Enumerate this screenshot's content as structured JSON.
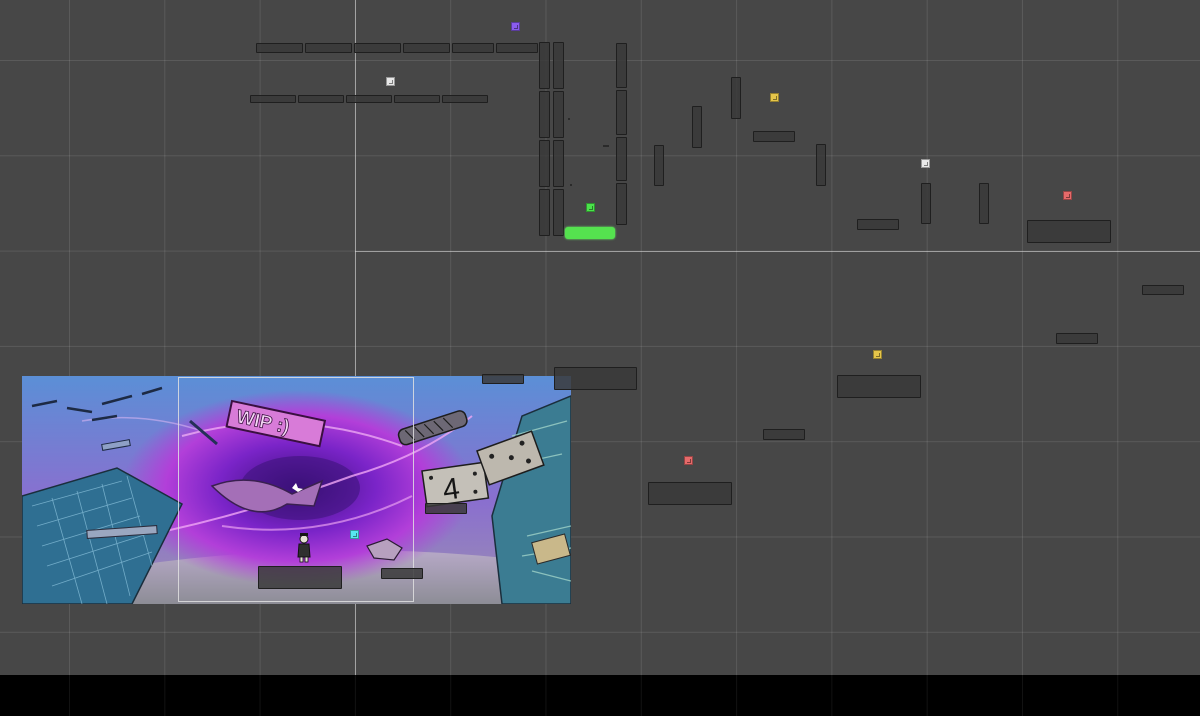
{
  "scene": {
    "background_color": "#474747",
    "grid_color": "#5a5a5a",
    "bottom_bar_color": "#000000",
    "platform_fill": "#3a3a3a",
    "platform_outline": "#1f1f1f",
    "goal_platform_color": "#55e24f"
  },
  "markers": [
    {
      "color": "#8a5cf0",
      "icon": "purple-marker-icon"
    },
    {
      "color": "#e8e8e8",
      "icon": "white-marker-icon"
    },
    {
      "color": "#e6c64a",
      "icon": "yellow-marker-icon"
    },
    {
      "color": "#e8e8e8",
      "icon": "white-marker-icon"
    },
    {
      "color": "#e66a6a",
      "icon": "red-marker-icon"
    },
    {
      "color": "#4be34b",
      "icon": "green-marker-icon"
    },
    {
      "color": "#e6c64a",
      "icon": "yellow-marker-icon"
    },
    {
      "color": "#e66a6a",
      "icon": "red-marker-icon"
    },
    {
      "color": "#58e6f0",
      "icon": "cyan-marker-icon"
    }
  ],
  "background_art": {
    "sign_text": "WIP :)",
    "dice_number": "4",
    "sky_color": "#6a8ad0",
    "vortex_color": "#9a2fd6",
    "building_color": "#3f7c9a"
  },
  "player": {
    "icon": "player-character-icon"
  }
}
